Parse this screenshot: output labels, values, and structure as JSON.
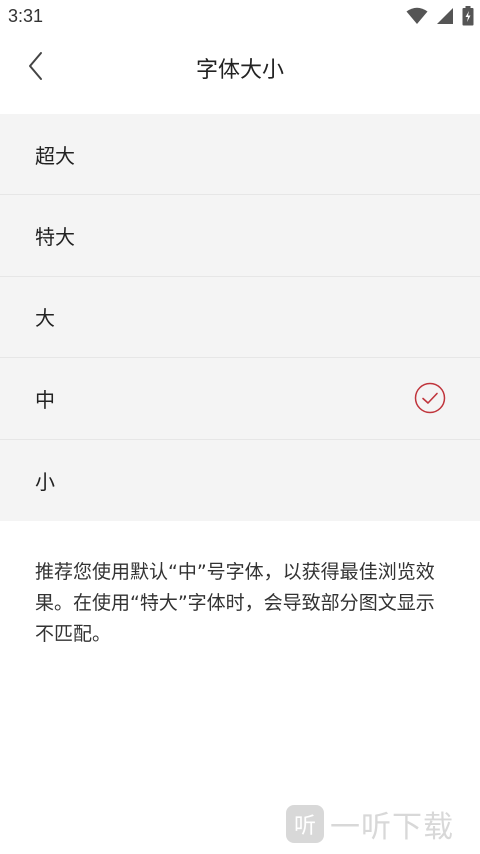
{
  "status_bar": {
    "time": "3:31",
    "icons": [
      "wifi-icon",
      "cellular-signal-icon",
      "battery-icon"
    ]
  },
  "header": {
    "title": "字体大小",
    "back_icon": "chevron-left-icon"
  },
  "font_options": [
    {
      "label": "超大",
      "selected": false
    },
    {
      "label": "特大",
      "selected": false
    },
    {
      "label": "大",
      "selected": false
    },
    {
      "label": "中",
      "selected": true
    },
    {
      "label": "小",
      "selected": false
    }
  ],
  "note": "推荐您使用默认“中”号字体，以获得最佳浏览效果。在使用“特大”字体时，会导致部分图文显示不匹配。",
  "watermark": {
    "logo_text": "听",
    "text": "一听下载"
  },
  "colors": {
    "accent": "#c0353c",
    "list_background": "#f4f4f4",
    "divider": "#e6e6e6"
  }
}
